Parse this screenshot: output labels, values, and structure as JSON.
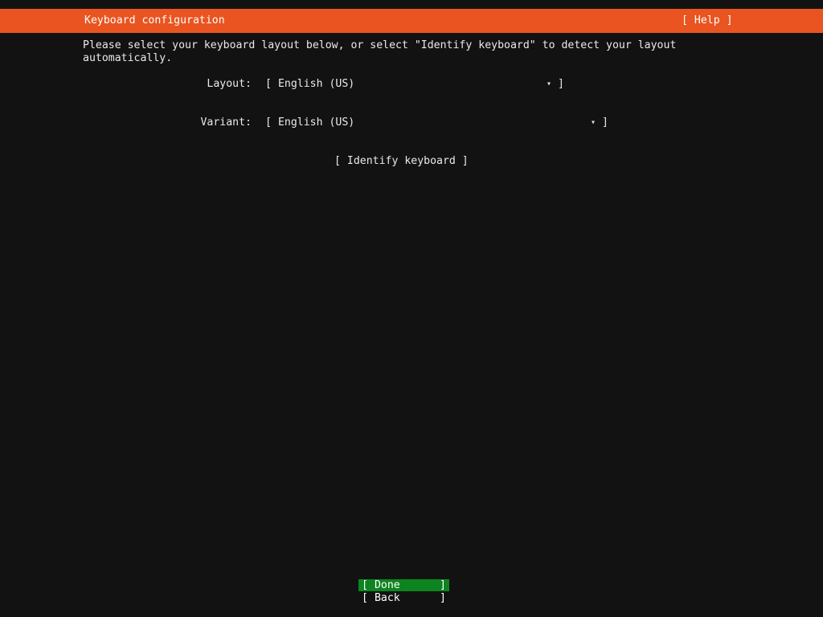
{
  "colors": {
    "accent-orange": "#E95420",
    "focus-green": "#0E8420",
    "background": "#121212",
    "text": "#EAEAEA"
  },
  "header": {
    "title": "Keyboard configuration",
    "help_label": "[ Help ]"
  },
  "instructions": "Please select your keyboard layout below, or select \"Identify keyboard\" to detect your layout automatically.",
  "form": {
    "layout": {
      "label": "Layout:",
      "open_bracket": "[",
      "value": "English (US)",
      "arrow": "▾",
      "close_bracket": "]"
    },
    "variant": {
      "label": "Variant:",
      "open_bracket": "[",
      "value": "English (US)",
      "arrow": "▾",
      "close_bracket": "]"
    }
  },
  "buttons": {
    "identify": {
      "label": "[ Identify keyboard ]"
    },
    "done": {
      "open_bracket": "[",
      "label": "Done",
      "close_bracket": "]"
    },
    "back": {
      "open_bracket": "[",
      "label": "Back",
      "close_bracket": "]"
    }
  }
}
